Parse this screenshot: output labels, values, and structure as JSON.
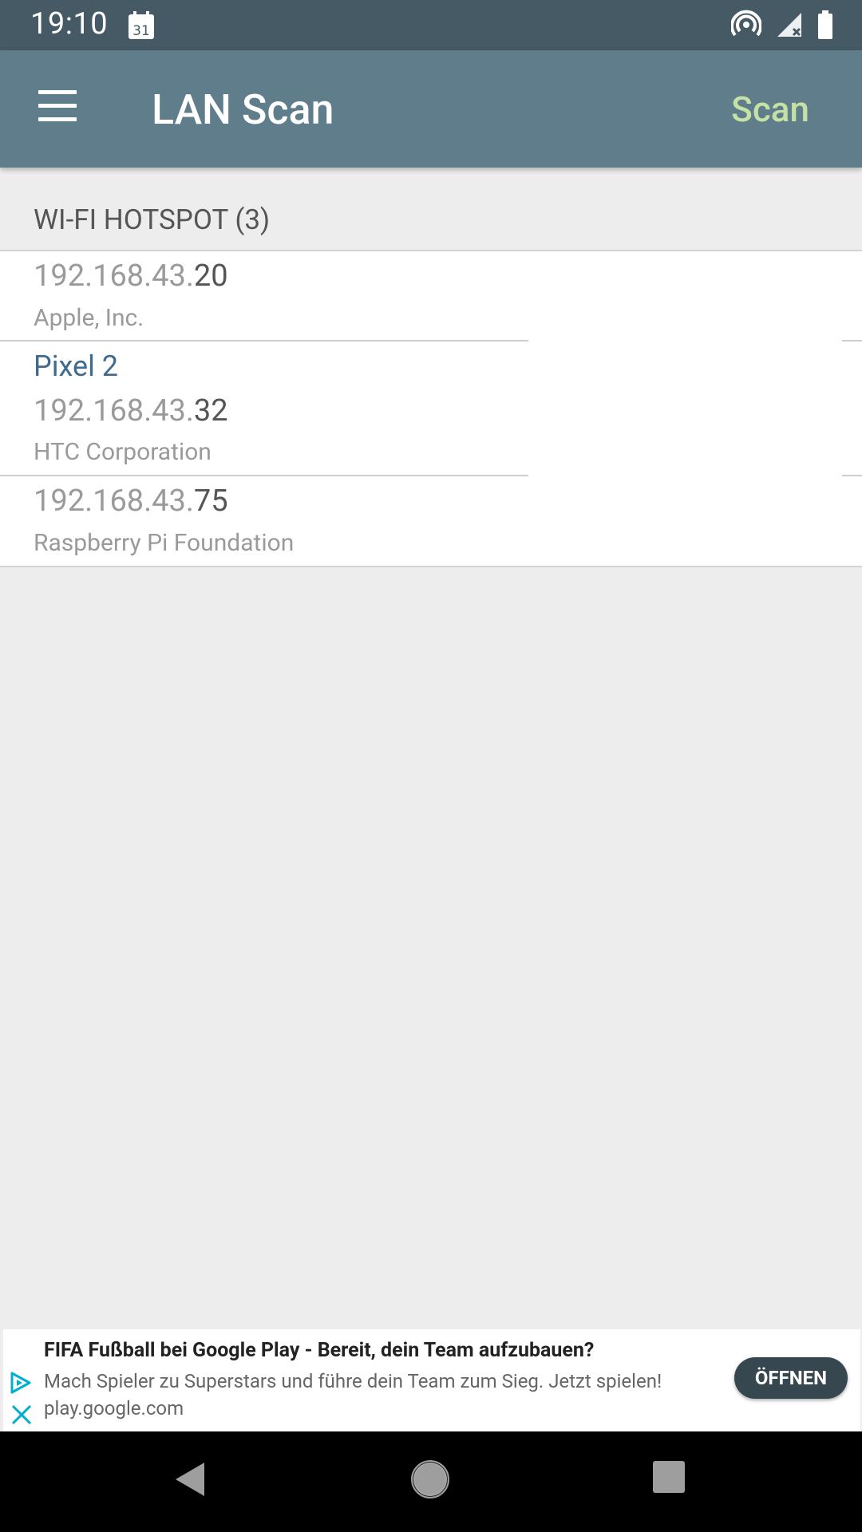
{
  "status_bar": {
    "time": "19:10",
    "calendar_day": "31",
    "icons": [
      "hotspot-icon",
      "signal-icon",
      "battery-icon"
    ]
  },
  "app_bar": {
    "title": "LAN Scan",
    "action_label": "Scan",
    "menu_icon": "hamburger-menu-icon"
  },
  "section": {
    "title": "WI-FI HOTSPOT (3)"
  },
  "devices": [
    {
      "ip_prefix": "192.168.43.",
      "ip_last": "20",
      "name": "",
      "vendor": "Apple, Inc."
    },
    {
      "ip_prefix": "192.168.43.",
      "ip_last": "32",
      "name": "Pixel 2",
      "vendor": "HTC Corporation"
    },
    {
      "ip_prefix": "192.168.43.",
      "ip_last": "75",
      "name": "",
      "vendor": "Raspberry Pi Foundation"
    }
  ],
  "ad": {
    "headline": "FIFA Fußball bei Google Play - Bereit, dein Team aufzubauen?",
    "body": "Mach Spieler zu Superstars und führe dein Team zum Sieg. Jetzt spielen! play.google.com",
    "cta": "ÖFFNEN"
  },
  "colors": {
    "status_bar": "#455a64",
    "app_bar": "#607d8b",
    "scan_action": "#c5e1a5",
    "device_name": "#3f6b8f",
    "ad_button": "#37474f"
  }
}
